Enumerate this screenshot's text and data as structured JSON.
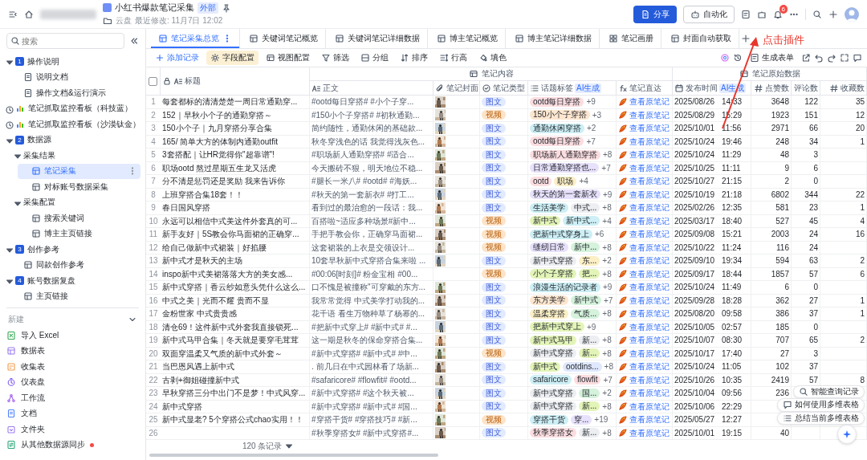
{
  "header": {
    "location": "云盘",
    "modified": "最近修改: 11月7日 12:02",
    "title": "小红书爆款笔记采集",
    "tag": "外部",
    "share": "分享",
    "automation": "自动化",
    "notification_count": "6"
  },
  "annotation": {
    "text": "点击插件"
  },
  "sidebar": {
    "placeholder": "搜索",
    "tree": [
      {
        "label": "操作说明",
        "kind": "section",
        "badge": "1",
        "expanded": true,
        "selected": false,
        "children": [
          {
            "label": "说明文档",
            "kind": "doc",
            "selected": false
          },
          {
            "label": "操作文档&运行演示",
            "kind": "doc",
            "selected": false
          }
        ]
      },
      {
        "label": "笔记抓取监控看板（科技蓝）",
        "kind": "dashboard",
        "selected": false
      },
      {
        "label": "笔记抓取监控看板（沙漠钛金）",
        "kind": "dashboard",
        "selected": false
      },
      {
        "label": "数据源",
        "kind": "section",
        "badge": "2",
        "expanded": true,
        "selected": false,
        "children": [
          {
            "label": "采集结果",
            "kind": "group",
            "expanded": true,
            "selected": false,
            "children": [
              {
                "label": "笔记采集",
                "kind": "table",
                "selected": true
              },
              {
                "label": "对标账号数据采集",
                "kind": "table",
                "selected": false
              }
            ]
          },
          {
            "label": "采集配置",
            "kind": "group",
            "expanded": true,
            "selected": false,
            "children": [
              {
                "label": "搜索关键词",
                "kind": "table",
                "selected": false
              },
              {
                "label": "博主主页链接",
                "kind": "table",
                "selected": false
              }
            ]
          }
        ]
      },
      {
        "label": "创作参考",
        "kind": "section",
        "badge": "3",
        "expanded": true,
        "selected": false,
        "children": [
          {
            "label": "同款创作参考",
            "kind": "table",
            "selected": false
          }
        ]
      },
      {
        "label": "账号数据复盘",
        "kind": "section",
        "badge": "4",
        "expanded": true,
        "selected": false,
        "children": [
          {
            "label": "主页链接",
            "kind": "table",
            "selected": false
          }
        ]
      }
    ],
    "new_section": {
      "label": "新建",
      "expanded": true,
      "items": [
        {
          "label": "导入 Excel",
          "kind": "excel",
          "dot": false
        },
        {
          "label": "数据表",
          "kind": "sheet",
          "dot": false
        },
        {
          "label": "收集表",
          "kind": "form",
          "dot": false
        },
        {
          "label": "仪表盘",
          "kind": "dashboard",
          "dot": false
        },
        {
          "label": "工作流",
          "kind": "workflow",
          "dot": false
        },
        {
          "label": "文档",
          "kind": "doc",
          "dot": false
        },
        {
          "label": "文件夹",
          "kind": "folder",
          "dot": false
        },
        {
          "label": "从其他数据源同步",
          "kind": "sync",
          "dot": true
        }
      ]
    }
  },
  "tabs": [
    {
      "label": "笔记采集总览",
      "kind": "sheet",
      "selected": true
    },
    {
      "label": "关键词笔记概览",
      "kind": "sheet",
      "selected": false
    },
    {
      "label": "关键词笔记详细数据",
      "kind": "sheet",
      "selected": false
    },
    {
      "label": "博主笔记概览",
      "kind": "sheet",
      "selected": false
    },
    {
      "label": "博主笔记详细数据",
      "kind": "sheet",
      "selected": false
    },
    {
      "label": "笔记画册",
      "kind": "gallery",
      "selected": false
    },
    {
      "label": "封面自动获取",
      "kind": "sheet",
      "selected": false
    }
  ],
  "toolbar": {
    "items": [
      {
        "label": "添加记录",
        "kind": "add",
        "active": false
      },
      {
        "label": "字段配置",
        "kind": "fields",
        "active": true
      },
      {
        "label": "视图配置",
        "kind": "view",
        "active": false
      },
      {
        "label": "筛选",
        "kind": "filter",
        "active": false
      },
      {
        "label": "分组",
        "kind": "group",
        "active": false
      },
      {
        "label": "排序",
        "kind": "sort",
        "active": false
      },
      {
        "label": "行高",
        "kind": "height",
        "active": false
      },
      {
        "label": "填色",
        "kind": "fill",
        "active": false
      }
    ],
    "form_button": "生成表单"
  },
  "table": {
    "select_all": {
      "checked": false
    },
    "column_groups": [
      {
        "columns": [
          {
            "label": "标题",
            "kind": "title"
          }
        ]
      },
      {
        "label": "笔记内容",
        "columns": [
          {
            "label": "正文",
            "kind": "ai_text"
          },
          {
            "label": "笔记封面",
            "kind": "attachment"
          },
          {
            "label": "笔记类型",
            "kind": "select"
          },
          {
            "label": "话题标签",
            "kind": "multi",
            "badge": "AI生成"
          },
          {
            "label": "笔记直达",
            "kind": "formula"
          }
        ]
      },
      {
        "label": "笔记原始数据",
        "columns": [
          {
            "label": "发布时间",
            "kind": "date",
            "badge": "AI生成"
          },
          {
            "label": "点赞数",
            "kind": "number"
          },
          {
            "label": "评论数",
            "kind": "plain"
          },
          {
            "label": "收藏数",
            "kind": "number"
          }
        ]
      }
    ],
    "rows": [
      {
        "num": "1",
        "title": "每套都标的清清楚楚一周日常通勤穿...",
        "body": "#ootd每日穿搭# #小个子穿...",
        "cover": {
          "kind": "picture"
        },
        "type": {
          "label": "图文"
        },
        "tags": [
          {
            "label": "ootd每日穿搭",
            "color": "#fbdde0"
          }
        ],
        "more": "+9",
        "link": "查看原笔记",
        "date": "2025/08/26",
        "time": "14:33",
        "likes": "3648",
        "comments": "122",
        "collects": "35"
      },
      {
        "num": "2",
        "title": "152｜早秋小个子的通勤穿搭～",
        "body": "#150小个子穿搭# #初秋通勤...",
        "cover": {
          "kind": "picture"
        },
        "type": {
          "label": "视频",
          "kind": "video"
        },
        "tags": [
          {
            "label": "150小个子穿搭",
            "color": "#fde6cf"
          }
        ],
        "more": "+3",
        "link": "查看原笔记",
        "date": "2025/08/29",
        "time": "15:29",
        "likes": "1923",
        "comments": "151",
        "collects": "12"
      },
      {
        "num": "3",
        "title": "150小个子｜九月穿搭分享合集",
        "body": "简约随性，通勤休闲的基础款...",
        "cover": {
          "kind": "picture"
        },
        "type": {
          "label": "图文"
        },
        "tags": [
          {
            "label": "通勤休闲穿搭",
            "color": "#cdeff5"
          }
        ],
        "more": "+2",
        "link": "查看原笔记",
        "date": "2025/10/01",
        "time": "11:56",
        "likes": "2971",
        "comments": "66",
        "collects": "20"
      },
      {
        "num": "4",
        "title": "165/ 简单大方的体制内通勤outfit",
        "body": "秋冬穿浅色的话 我觉得浅灰色...",
        "cover": {
          "kind": "picture"
        },
        "type": {
          "label": "图文"
        },
        "tags": [
          {
            "label": "ootd每日穿搭",
            "color": "#fbdde0"
          }
        ],
        "more": "+7",
        "link": "查看原笔记",
        "date": "2025/10/24",
        "time": "19:46",
        "likes": "248",
        "comments": "34",
        "collects": "1"
      },
      {
        "num": "5",
        "title": "3套搭配｜让HR觉得你\"超靠谱\"!",
        "body": "#职场新人通勤穿搭# #适合...",
        "cover": {
          "kind": "picture"
        },
        "type": {
          "label": "图文"
        },
        "tags": [
          {
            "label": "职场新人通勤穿搭",
            "color": "#fbdde0"
          }
        ],
        "more": "+8",
        "link": "查看原笔记",
        "date": "2025/10/24",
        "time": "11:29",
        "likes": "48",
        "comments": "3"
      },
      {
        "num": "6",
        "title": "职场ootd 熬过星期五生龙又活虎",
        "body": "今天搬砖不狠，明天地位不稳...",
        "cover": {
          "kind": "picture"
        },
        "type": {
          "label": "图文"
        },
        "tags": [
          {
            "label": "日常通勤穿搭也...",
            "color": "#e8e1fb"
          }
        ],
        "more": "+7",
        "link": "查看原笔记",
        "date": "2025/10/25",
        "time": "11:11",
        "likes": "9",
        "comments": "6"
      },
      {
        "num": "7",
        "title": "分不清是惩罚还是奖励 我来告诉你",
        "body": "#腿长一米八# #ootd# #海妖...",
        "cover": {
          "kind": "picture"
        },
        "type": {
          "label": "图文"
        },
        "tags": [
          {
            "label": "ootd",
            "color": "#fbdde0"
          },
          {
            "label": "职场",
            "color": "#fcefc5"
          }
        ],
        "more": "+4",
        "link": "查看原笔记",
        "date": "2025/10/27",
        "time": "21:15",
        "likes": "2",
        "comments": "0"
      },
      {
        "num": "8",
        "title": "上班穿搭合集18套！！",
        "body": "#秋天的第一套新衣# #打工...",
        "cover": {
          "kind": "picture"
        },
        "type": {
          "label": "图文"
        },
        "tags": [
          {
            "label": "秋天的第一套新衣",
            "color": "#e8e1fb"
          }
        ],
        "more": "+9",
        "link": "查看原笔记",
        "date": "2025/10/19",
        "time": "21:18",
        "likes": "6802",
        "comments": "344",
        "collects": "22"
      },
      {
        "num": "9",
        "title": "春日国风穿搭",
        "body": "看到过的最治愈的一段话：我...",
        "cover": {
          "kind": "picture"
        },
        "type": {
          "label": "图文"
        },
        "tags": [
          {
            "label": "生活美学",
            "color": "#cdeff5"
          },
          {
            "label": "中式...",
            "color": "#eceef1"
          }
        ],
        "more": "+8",
        "link": "查看原笔记",
        "date": "2025/02/26",
        "time": "12:35",
        "likes": "581",
        "comments": "23",
        "collects": "1"
      },
      {
        "num": "10",
        "title": "永远可以相信中式美这件外套真的可...",
        "body": "百搭啦~适应多种场景#新中...",
        "cover": {
          "kind": "picture"
        },
        "type": {
          "label": "视频",
          "kind": "video"
        },
        "tags": [
          {
            "label": "新中式",
            "color": "#e3f4b8"
          },
          {
            "label": "新中式...",
            "color": "#cdeff5"
          }
        ],
        "more": "+4",
        "link": "查看原笔记",
        "date": "2025/03/17",
        "time": "18:40",
        "likes": "527",
        "comments": "45",
        "collects": "4"
      },
      {
        "num": "11",
        "title": "新手友好｜5S教会你马面裙的正确穿...",
        "body": "手把手教会你，正确穿马面裙...",
        "cover": {
          "kind": "picture"
        },
        "type": {
          "label": "视频",
          "kind": "video"
        },
        "tags": [
          {
            "label": "把新中式穿身上",
            "color": "#cdeff5"
          }
        ],
        "more": "+6",
        "link": "查看原笔记",
        "date": "2025/09/08",
        "time": "15:21",
        "likes": "2003",
        "comments": "24",
        "collects": "16"
      },
      {
        "num": "12",
        "title": "给自己做新中式裙装｜好掐腰",
        "body": "这套裙装的上衣是交领设计...",
        "cover": {
          "kind": "picture"
        },
        "type": {
          "label": "视频",
          "kind": "video"
        },
        "tags": [
          {
            "label": "缝纫日常",
            "color": "#e8e1fb"
          },
          {
            "label": "新中...",
            "color": "#d5f2dc"
          }
        ],
        "more": "+8",
        "link": "查看原笔记",
        "date": "2025/10/22",
        "time": "11:24",
        "likes": "116",
        "comments": "24"
      },
      {
        "num": "13",
        "title": "新中式才是秋天的主场",
        "body": "10套早秋新中式穿搭合集来啦 ...",
        "cover": {
          "kind": "picture"
        },
        "type": {
          "label": "图文"
        },
        "tags": [
          {
            "label": "新中式穿搭",
            "color": "#eceef1"
          },
          {
            "label": "东...",
            "color": "#fcefc5"
          }
        ],
        "more": "+2",
        "link": "查看原笔记",
        "date": "2025/09/10",
        "time": "19:34",
        "likes": "594",
        "comments": "63",
        "collects": "2"
      },
      {
        "num": "14",
        "title": "inspo新中式美裙落落大方的美女感...",
        "body": "#00:06[时刻]# 粉金宝相 #00...",
        "type": {
          "label": "视频",
          "kind": "video"
        },
        "tags": [
          {
            "label": "小个子穿搭",
            "color": "#e3f4b8"
          },
          {
            "label": "把...",
            "color": "#e3f4b8"
          }
        ],
        "more": "+8",
        "link": "查看原笔记",
        "date": "2025/09/17",
        "time": "18:44",
        "likes": "1857",
        "comments": "57",
        "collects": "6"
      },
      {
        "num": "15",
        "title": "新中式穿搭｜香云纱如意头凭什么这么...",
        "body": "口不愧是被撞称\"可穿戴的东方...",
        "cover": {
          "kind": "picture"
        },
        "type": {
          "label": "图文"
        },
        "tags": [
          {
            "label": "浪漫生活的记录者",
            "color": "#cdeff5"
          }
        ],
        "more": "+9",
        "link": "查看原笔记",
        "date": "2025/10/24",
        "time": "11:49",
        "likes": "6",
        "comments": "0"
      },
      {
        "num": "16",
        "title": "中式之美｜光而不耀 贵而不显",
        "body": "我常常觉得 中式美学打动我的...",
        "cover": {
          "kind": "picture"
        },
        "type": {
          "label": "图文"
        },
        "tags": [
          {
            "label": "东方美学",
            "color": "#fde6cf"
          },
          {
            "label": "新中式",
            "color": "#d5f2dc"
          }
        ],
        "more": "+7",
        "link": "查看原笔记",
        "date": "2025/09/28",
        "time": "18:28",
        "likes": "362",
        "comments": "27",
        "collects": "1"
      },
      {
        "num": "17",
        "title": "金粉世家 中式贵贵感",
        "body": "花千语 看生万物种草了杨幂的...",
        "cover": {
          "kind": "picture"
        },
        "type": {
          "label": "图文"
        },
        "tags": [
          {
            "label": "温柔穿搭",
            "color": "#fcefc5"
          },
          {
            "label": "气质...",
            "color": "#d5f2dc"
          }
        ],
        "more": "+8",
        "link": "查看原笔记",
        "date": "2025/08/20",
        "time": "09:58",
        "likes": "386",
        "comments": "37",
        "collects": "1"
      },
      {
        "num": "18",
        "title": "清仓69！这件新中式外套我直接锁死...",
        "body": "#把新中式穿上# #新中式# #...",
        "cover": {
          "kind": "picture"
        },
        "type": {
          "label": "图文"
        },
        "tags": [
          {
            "label": "把新中式穿上",
            "color": "#e3f4b8"
          }
        ],
        "more": "+9",
        "link": "查看原笔记",
        "date": "2025/10/05",
        "time": "02:57",
        "likes": "185",
        "comments": "0"
      },
      {
        "num": "19",
        "title": "新中式马甲合集｜冬天就是要穿毛茸茸",
        "body": "这一期是秋冬的保命穿搭合集...",
        "cover": {
          "kind": "picture"
        },
        "type": {
          "label": "图文"
        },
        "tags": [
          {
            "label": "新中式马甲",
            "color": "#e3f4b8"
          },
          {
            "label": "新...",
            "color": "#eceef1"
          }
        ],
        "more": "+8",
        "link": "查看原笔记",
        "date": "2025/10/07",
        "time": "08:30",
        "likes": "707",
        "comments": "65",
        "collects": "2"
      },
      {
        "num": "20",
        "title": "双面穿温柔又气质的新中式外套～",
        "body": "#新中式穿搭# #新中式# #中...",
        "cover": {
          "kind": "picture"
        },
        "type": {
          "label": "视频",
          "kind": "video"
        },
        "tags": [
          {
            "label": "新中式穿搭",
            "color": "#eceef1"
          },
          {
            "label": "新...",
            "color": "#e3f4b8"
          }
        ],
        "more": "+8",
        "link": "查看原笔记",
        "date": "2025/10/17",
        "time": "17:40",
        "likes": "27",
        "comments": "3"
      },
      {
        "num": "21",
        "title": "当巴恩风遇上新中式",
        "body": ". 前几日在中式园林看了场新...",
        "cover": {
          "kind": "picture"
        },
        "type": {
          "label": "图文"
        },
        "tags": [
          {
            "label": "新中式",
            "color": "#e3f4b8"
          },
          {
            "label": "ootdins...",
            "color": "#dfe8fd"
          }
        ],
        "more": "+8",
        "link": "查看原笔记",
        "date": "2025/10/24",
        "time": "11:05",
        "likes": "102",
        "comments": "37"
      },
      {
        "num": "22",
        "title": "古剥+御姐碰撞新中式",
        "body": "#safaricore# #flowfit# #ootd...",
        "cover": {
          "kind": "picture"
        },
        "type": {
          "label": "图文"
        },
        "tags": [
          {
            "label": "safaricore",
            "color": "#cdeff5"
          },
          {
            "label": "flowfit",
            "color": "#fbdde0"
          }
        ],
        "more": "+7",
        "link": "查看原笔记",
        "date": "2025/10/26",
        "time": "10:35",
        "likes": "2419",
        "comments": "57",
        "collects": "8"
      },
      {
        "num": "23",
        "title": "早秋穿搭三分中出门不是梦！中式风穿...",
        "body": "#新中式穿搭# #这个秋天被...",
        "cover": {
          "kind": "picture"
        },
        "type": {
          "label": "图文"
        },
        "tags": [
          {
            "label": "新中式穿搭",
            "color": "#eceef1"
          },
          {
            "label": "国...",
            "color": "#d5f2dc"
          }
        ],
        "more": "+2",
        "link": "查看原笔记",
        "date": "2025/10/04",
        "time": "09:56",
        "likes": "236"
      },
      {
        "num": "24",
        "title": "新中式穿搭",
        "body": "#新中式穿搭# #新中式# #国...",
        "cover": {
          "kind": "picture"
        },
        "type": {
          "label": "图文"
        },
        "tags": [
          {
            "label": "新中式穿搭",
            "color": "#eceef1"
          },
          {
            "label": "新...",
            "color": "#e3f4b8"
          }
        ],
        "more": "+8",
        "link": "查看原笔记",
        "date": "2025/10/06",
        "time": "22:29"
      },
      {
        "num": "25",
        "title": "新中式显老? 5个穿搭公式chao实用！！",
        "body": "#穿搭干货# #穿搭技巧# #新...",
        "cover": {
          "kind": "picture"
        },
        "type": {
          "label": "视频",
          "kind": "video"
        },
        "tags": [
          {
            "label": "穿搭干货",
            "color": "#cdeff5"
          },
          {
            "label": "穿...",
            "color": "#e8e1fb"
          }
        ],
        "more": "+19",
        "link": "查看原笔记",
        "date": "2025/05/27",
        "time": "12:27"
      },
      {
        "num": "26",
        "body": "#秋季穿搭女# #新中式穿搭#...",
        "cover": {
          "kind": "picture"
        },
        "type": {
          "label": "图文"
        },
        "tags": [
          {
            "label": "秋季穿搭女",
            "color": "#fbdde0"
          },
          {
            "label": "新...",
            "color": "#eceef1"
          }
        ],
        "more": "+8",
        "link": "查看原笔记",
        "date": "2025/10/01",
        "time": "19:15",
        "likes": "40"
      }
    ],
    "record_count": "120 条记录"
  },
  "assistant_menu": [
    "智能查询记录",
    "如何使用多维表格",
    "总结当前多维表格"
  ]
}
